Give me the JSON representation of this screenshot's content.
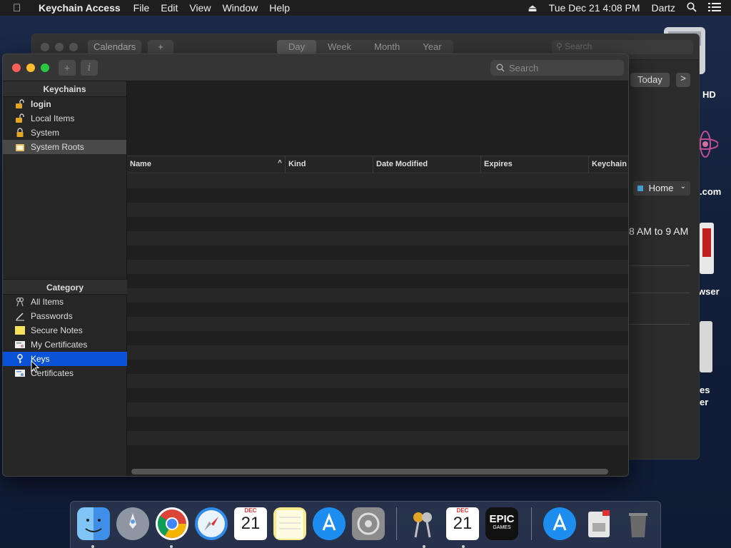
{
  "menubar": {
    "app_name": "Keychain Access",
    "menus": [
      "File",
      "Edit",
      "View",
      "Window",
      "Help"
    ],
    "clock": "Tue Dec 21  4:08 PM",
    "user": "Dartz"
  },
  "calendar_window": {
    "calendars_label": "Calendars",
    "add_label": "+",
    "views": [
      "Day",
      "Week",
      "Month",
      "Year"
    ],
    "search_placeholder": "Search",
    "today_label": "Today",
    "next_label": ">",
    "calendar_select": "Home",
    "event_time": "8 AM to 9 AM"
  },
  "desktop": {
    "labels": [
      "HD",
      ".com",
      "wser",
      "es",
      "er"
    ]
  },
  "keychain_window": {
    "add_label": "+",
    "info_label": "i",
    "search_placeholder": "Search",
    "keychains_header": "Keychains",
    "keychains": [
      {
        "label": "login",
        "icon": "unlocked-lock-icon"
      },
      {
        "label": "Local Items",
        "icon": "unlocked-lock-icon"
      },
      {
        "label": "System",
        "icon": "locked-lock-icon"
      },
      {
        "label": "System Roots",
        "icon": "folder-cert-icon"
      }
    ],
    "category_header": "Category",
    "categories": [
      {
        "label": "All Items",
        "icon": "all-items-icon"
      },
      {
        "label": "Passwords",
        "icon": "pen-icon"
      },
      {
        "label": "Secure Notes",
        "icon": "note-icon"
      },
      {
        "label": "My Certificates",
        "icon": "certificate-icon"
      },
      {
        "label": "Keys",
        "icon": "key-icon"
      },
      {
        "label": "Certificates",
        "icon": "certificate-icon"
      }
    ],
    "columns": [
      "Name",
      "Kind",
      "Date Modified",
      "Expires",
      "Keychain"
    ],
    "sort_indicator": "^"
  },
  "dock": {
    "calendar_month": "DEC",
    "calendar_day": "21",
    "epic_label": "EPIC",
    "epic_sub": "GAMES"
  }
}
